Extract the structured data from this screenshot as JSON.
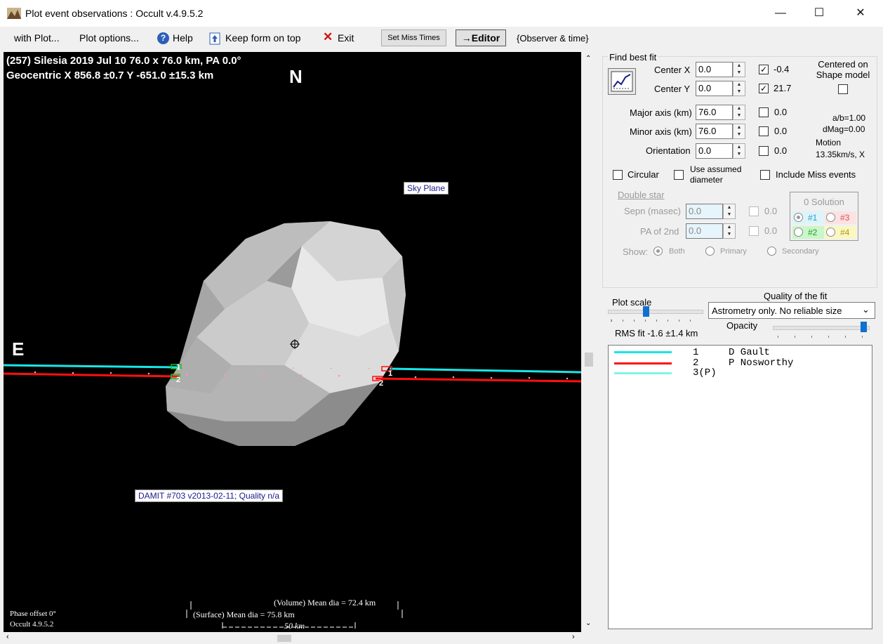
{
  "window": {
    "title": "Plot event observations : Occult v.4.9.5.2",
    "minimize": "—",
    "maximize": "☐",
    "close": "✕"
  },
  "menu": {
    "with_plot": "with Plot...",
    "plot_options": "Plot options...",
    "help": "Help",
    "keep_form": "Keep form on top",
    "exit": "Exit",
    "set_miss_times": "Set Miss Times",
    "editor": "→Editor",
    "observer_time": "{Observer & time}"
  },
  "plot": {
    "header_line1": "(257) Silesia  2019 Jul 10   76.0 x 76.0 km, PA 0.0°",
    "header_line2": "Geocentric X  856.8 ±0.7  Y -651.0 ±15.3 km",
    "north": "N",
    "east": "E",
    "sky_plane": "Sky Plane",
    "damit": "DAMIT #703 v2013-02-11; Quality n/a",
    "volume_dia": "(Volume) Mean dia = 72.4 km",
    "surface_dia": "(Surface) Mean dia = 75.8 km",
    "scale_bar": "50 km",
    "phase_offset": "Phase offset 0°",
    "version": "Occult 4.9.5.2",
    "chord_label_1": "1",
    "chord_label_2": "2",
    "chord_colors": {
      "observer1": "#19e6e6",
      "observer2": "#ff1010"
    }
  },
  "fit": {
    "group_title": "Find best fit",
    "center_x_label": "Center X",
    "center_x_value": "0.0",
    "center_x_check": "-0.4",
    "center_y_label": "Center Y",
    "center_y_value": "0.0",
    "center_y_check": "21.7",
    "major_label": "Major axis (km)",
    "major_value": "76.0",
    "major_check": "0.0",
    "minor_label": "Minor axis (km)",
    "minor_value": "76.0",
    "minor_check": "0.0",
    "orient_label": "Orientation",
    "orient_value": "0.0",
    "orient_check": "0.0",
    "centered_shape": "Centered on Shape model",
    "ab_ratio": "a/b=1.00",
    "dmag": "dMag=0.00",
    "motion_label": "Motion",
    "motion_value": "13.35km/s, X",
    "circular": "Circular",
    "use_assumed": "Use assumed diameter",
    "include_miss": "Include Miss events"
  },
  "double_star": {
    "title": "Double star",
    "sepn_label": "Sepn (masec)",
    "sepn_value": "0.0",
    "sepn_check": "0.0",
    "pa_label": "PA of 2nd",
    "pa_value": "0.0",
    "pa_check": "0.0",
    "show_label": "Show:",
    "show_both": "Both",
    "show_primary": "Primary",
    "show_secondary": "Secondary",
    "solution_title": "0 Solution",
    "sol1": "#1",
    "sol2": "#2",
    "sol3": "#3",
    "sol4": "#4"
  },
  "scale": {
    "plot_scale": "Plot scale",
    "rms_fit": "RMS fit -1.6 ±1.4 km",
    "quality_label": "Quality of the fit",
    "quality_value": "Astrometry only. No reliable size",
    "opacity": "Opacity"
  },
  "legend": [
    {
      "num": "1",
      "name": "D Gault",
      "color": "#19e6e6"
    },
    {
      "num": "2",
      "name": "P Nosworthy",
      "color": "#ff1010"
    },
    {
      "num": "3(P)",
      "name": "",
      "color": "#7ff5e8"
    }
  ]
}
